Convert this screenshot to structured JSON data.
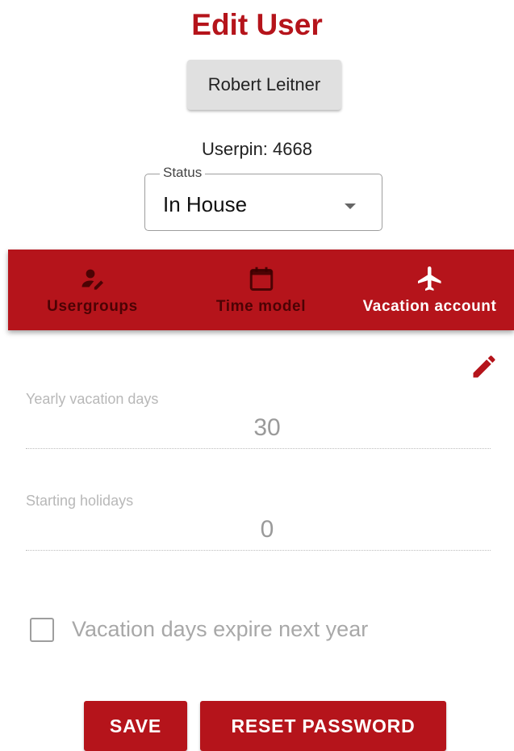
{
  "page": {
    "title": "Edit User"
  },
  "user": {
    "name": "Robert Leitner",
    "userpin": "Userpin: 4668"
  },
  "status": {
    "label": "Status",
    "value": "In House"
  },
  "tabs": [
    {
      "label": "Usergroups",
      "icon": "person-edit-icon",
      "active": false
    },
    {
      "label": "Time model",
      "icon": "calendar-icon",
      "active": false
    },
    {
      "label": "Vacation account",
      "icon": "airplane-icon",
      "active": true
    }
  ],
  "vacation": {
    "yearly_label": "Yearly vacation days",
    "yearly_value": "30",
    "starting_label": "Starting holidays",
    "starting_value": "0",
    "expire_label": "Vacation days expire next year",
    "expire_checked": false
  },
  "actions": {
    "save_label": "SAVE",
    "reset_label": "RESET PASSWORD"
  },
  "colors": {
    "brand": "#b5141b",
    "inactive_tab_text": "#3a0000"
  }
}
